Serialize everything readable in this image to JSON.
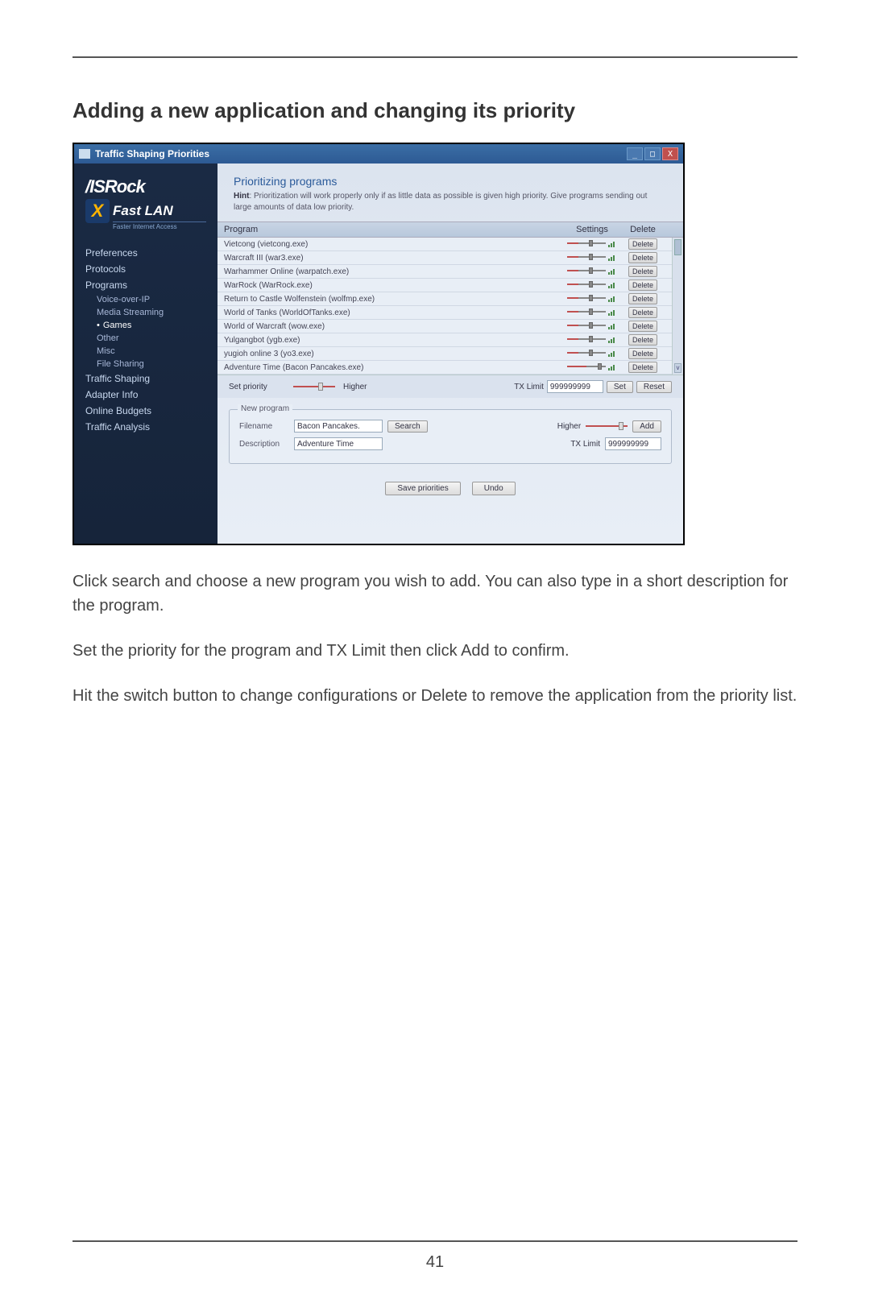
{
  "doc": {
    "section_title": "Adding a new application and changing its priority",
    "para1": "Click search and choose a new program you wish to add. You can also type in a short description for the program.",
    "para2": "Set the priority for the program and TX Limit then click Add to confirm.",
    "para3": "Hit the switch button to change configurations or Delete to remove the application from the priority list.",
    "page_number": "41"
  },
  "window": {
    "title": "Traffic Shaping Priorities",
    "min": "_",
    "max": "□",
    "close": "X"
  },
  "brand": {
    "logo": "/ISRock",
    "product": "Fast LAN",
    "x": "X",
    "tag": "Faster Internet Access"
  },
  "sidebar": {
    "items": [
      {
        "label": "Preferences",
        "sub": false
      },
      {
        "label": "Protocols",
        "sub": false
      },
      {
        "label": "Programs",
        "sub": false
      },
      {
        "label": "Voice-over-IP",
        "sub": true
      },
      {
        "label": "Media Streaming",
        "sub": true
      },
      {
        "label": "Games",
        "sub": true,
        "active": true
      },
      {
        "label": "Other",
        "sub": true
      },
      {
        "label": "Misc",
        "sub": true
      },
      {
        "label": "File Sharing",
        "sub": true
      },
      {
        "label": "Traffic Shaping",
        "sub": false
      },
      {
        "label": "Adapter Info",
        "sub": false
      },
      {
        "label": "Online Budgets",
        "sub": false
      },
      {
        "label": "Traffic Analysis",
        "sub": false
      }
    ]
  },
  "main": {
    "title": "Prioritizing programs",
    "hint_label": "Hint",
    "hint_text": ": Prioritization will work properly only if as little data as possible is given high priority. Give programs sending out large amounts of data low priority.",
    "cols": {
      "program": "Program",
      "settings": "Settings",
      "delete": "Delete"
    },
    "rows": [
      {
        "name": "Vietcong (vietcong.exe)",
        "delete": "Delete"
      },
      {
        "name": "Warcraft III (war3.exe)",
        "delete": "Delete"
      },
      {
        "name": "Warhammer Online (warpatch.exe)",
        "delete": "Delete"
      },
      {
        "name": "WarRock (WarRock.exe)",
        "delete": "Delete"
      },
      {
        "name": "Return to Castle Wolfenstein (wolfmp.exe)",
        "delete": "Delete"
      },
      {
        "name": "World of Tanks (WorldOfTanks.exe)",
        "delete": "Delete"
      },
      {
        "name": "World of Warcraft (wow.exe)",
        "delete": "Delete"
      },
      {
        "name": "Yulgangbot (ygb.exe)",
        "delete": "Delete"
      },
      {
        "name": "yugioh online 3 (yo3.exe)",
        "delete": "Delete"
      },
      {
        "name": "Adventure Time (Bacon Pancakes.exe)",
        "delete": "Delete",
        "highlight": true
      }
    ],
    "setprio": {
      "label": "Set priority",
      "level": "Higher",
      "txlimit_label": "TX Limit",
      "txlimit_value": "999999999",
      "set": "Set",
      "reset": "Reset"
    },
    "newprog": {
      "legend": "New program",
      "filename_label": "Filename",
      "filename_value": "Bacon Pancakes.",
      "search": "Search",
      "desc_label": "Description",
      "desc_value": "Adventure Time",
      "level": "Higher",
      "add": "Add",
      "txlimit_label": "TX Limit",
      "txlimit_value": "999999999"
    },
    "footer": {
      "save": "Save priorities",
      "undo": "Undo"
    }
  }
}
